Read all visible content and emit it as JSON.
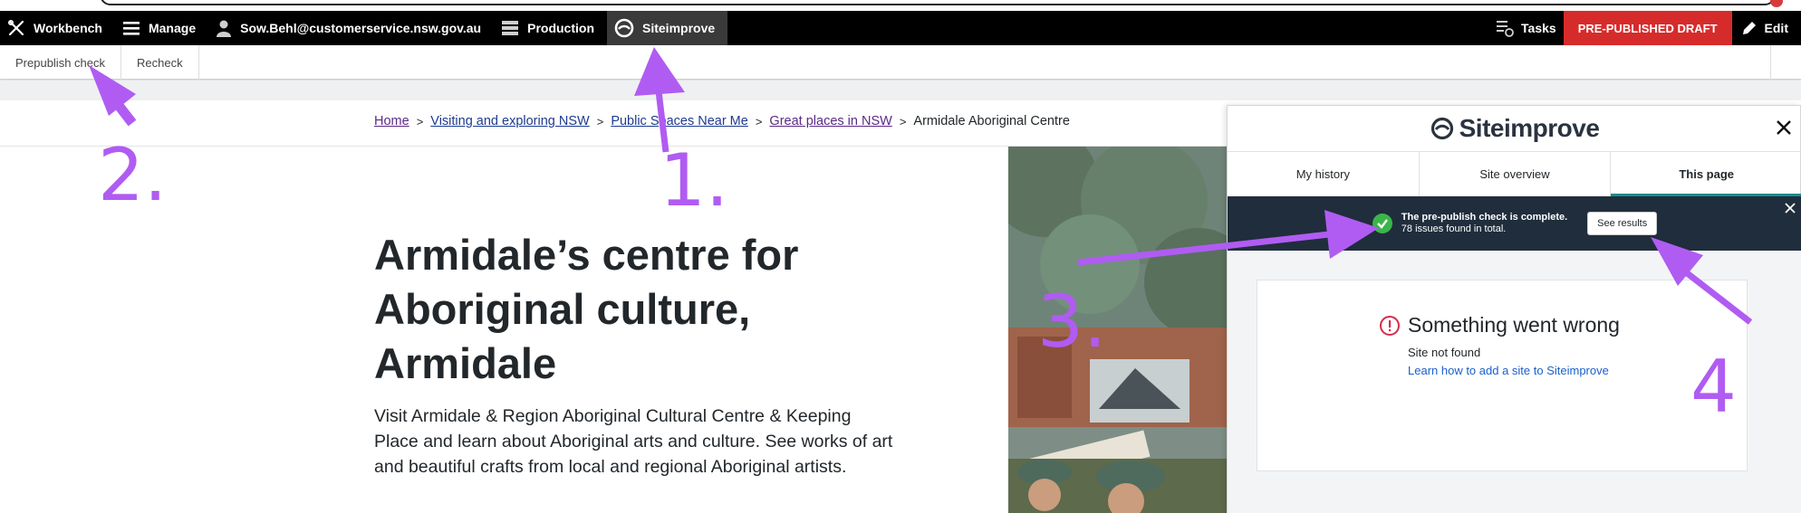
{
  "toolbar": {
    "workbench": "Workbench",
    "manage": "Manage",
    "user": "Sow.Behl@customerservice.nsw.gov.au",
    "production": "Production",
    "siteimprove": "Siteimprove",
    "tasks": "Tasks",
    "status_badge": "PRE-PUBLISHED DRAFT",
    "edit": "Edit"
  },
  "tray": {
    "prepublish": "Prepublish check",
    "recheck": "Recheck"
  },
  "breadcrumb": {
    "home": "Home",
    "visiting": "Visiting and exploring NSW",
    "public_spaces": "Public Spaces Near Me",
    "great_places": "Great places in NSW",
    "current": "Armidale Aboriginal Centre",
    "separator": ">"
  },
  "page": {
    "title": "Armidale’s centre for Aboriginal culture, Armidale",
    "intro": "Visit Armidale & Region Aboriginal Cultural Centre & Keeping Place and learn about Aboriginal arts and culture. See works of art and beautiful crafts from local and regional Aboriginal artists."
  },
  "siteimprove_panel": {
    "logo_text": "Siteimprove",
    "tabs": [
      "My history",
      "Site overview",
      "This page"
    ],
    "active_tab": "This page",
    "banner_line1": "The pre-publish check is complete.",
    "banner_line2": "78 issues found in total.",
    "see_results": "See results",
    "error_title": "Something went wrong",
    "error_sub": "Site not found",
    "error_link": "Learn how to add a site to Siteimprove"
  },
  "annotations": {
    "one": "1.",
    "two": "2.",
    "three": "3.",
    "four": "4",
    "color": "#b05cf2"
  },
  "colors": {
    "toolbar_bg": "#000000",
    "draft_badge": "#d62b2b",
    "banner_bg": "#202d3c",
    "success": "#3ab54a",
    "error": "#d62b4b",
    "link": "#1d3a8f"
  }
}
